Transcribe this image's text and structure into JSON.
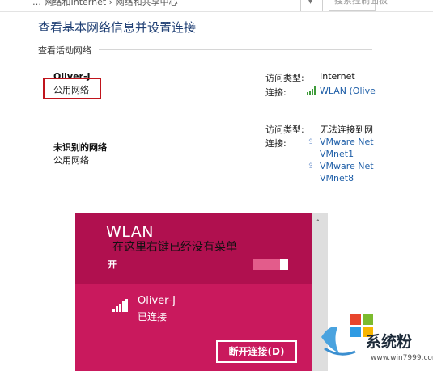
{
  "header": {
    "breadcrumb": "… 网络和Internet › 网络和共享中心",
    "search_placeholder": "搜索控制面板"
  },
  "page": {
    "title": "查看基本网络信息并设置连接",
    "section_label": "查看活动网络"
  },
  "networks": [
    {
      "name": "Oliver-J",
      "type": "公用网络",
      "access_label": "访问类型:",
      "access_value": "Internet",
      "conn_label": "连接:",
      "connections": [
        "WLAN (Olive"
      ]
    },
    {
      "name": "未识别的网络",
      "type": "公用网络",
      "access_label": "访问类型:",
      "access_value": "无法连接到网",
      "conn_label": "连接:",
      "connections": [
        "VMware Net",
        "VMnet1",
        "VMware Net",
        "VMnet8"
      ]
    }
  ],
  "flyout": {
    "title": "WLAN",
    "annotation": "在这里右键已经没有菜单",
    "toggle_label": "开",
    "toggle_on": true,
    "network_name": "Oliver-J",
    "network_status": "已连接",
    "disconnect_label": "断开连接(D)",
    "scroll_up_glyph": "˄"
  },
  "watermark": {
    "brand": "系统粉",
    "url": "www.win7999.com"
  },
  "colors": {
    "flyout_bg": "#c9195d",
    "flyout_header": "#b0104f",
    "title_blue": "#1f3f74",
    "link_blue": "#1f5fa8",
    "highlight_red": "#c0141c",
    "signal_green": "#3f9b3a"
  },
  "icons": {
    "wifi": "wifi-signal-icon",
    "ethernet": "ethernet-adapter-icon",
    "logo": "windows-logo-icon"
  }
}
